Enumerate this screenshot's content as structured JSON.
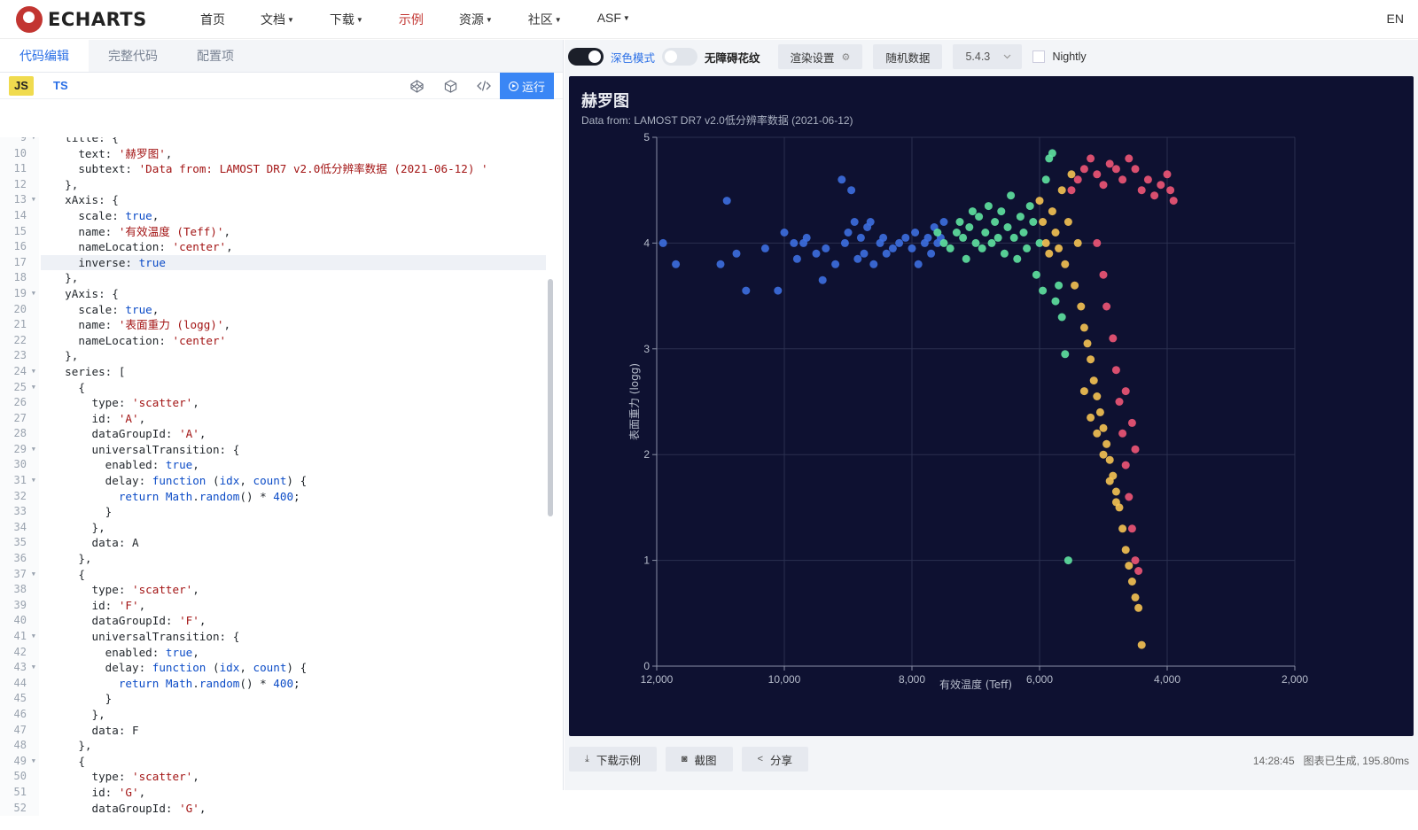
{
  "nav": {
    "brand": "ECHARTS",
    "items": [
      {
        "label": "首页",
        "caret": false,
        "active": false
      },
      {
        "label": "文档",
        "caret": true,
        "active": false
      },
      {
        "label": "下载",
        "caret": true,
        "active": false
      },
      {
        "label": "示例",
        "caret": false,
        "active": true
      },
      {
        "label": "资源",
        "caret": true,
        "active": false
      },
      {
        "label": "社区",
        "caret": true,
        "active": false
      },
      {
        "label": "ASF",
        "caret": true,
        "active": false
      }
    ],
    "lang": "EN"
  },
  "editor_tabs": [
    "代码编辑",
    "完整代码",
    "配置项"
  ],
  "lang_bar": {
    "js": "JS",
    "ts": "TS",
    "run": "运行"
  },
  "code_lines": [
    {
      "n": 9,
      "fold": true,
      "t": "  title: {"
    },
    {
      "n": 10,
      "t": "    text: '赫罗图',"
    },
    {
      "n": 11,
      "t": "    subtext: 'Data from: LAMOST DR7 v2.0低分辨率数据 (2021-06-12) '"
    },
    {
      "n": 12,
      "t": "  },"
    },
    {
      "n": 13,
      "fold": true,
      "t": "  xAxis: {"
    },
    {
      "n": 14,
      "t": "    scale: true,"
    },
    {
      "n": 15,
      "t": "    name: '有效温度 (Teff)',"
    },
    {
      "n": 16,
      "t": "    nameLocation: 'center',"
    },
    {
      "n": 17,
      "t": "    inverse: true",
      "hl": true
    },
    {
      "n": 18,
      "t": "  },"
    },
    {
      "n": 19,
      "fold": true,
      "t": "  yAxis: {"
    },
    {
      "n": 20,
      "t": "    scale: true,"
    },
    {
      "n": 21,
      "t": "    name: '表面重力 (logg)',"
    },
    {
      "n": 22,
      "t": "    nameLocation: 'center'"
    },
    {
      "n": 23,
      "t": "  },"
    },
    {
      "n": 24,
      "fold": true,
      "t": "  series: ["
    },
    {
      "n": 25,
      "fold": true,
      "t": "    {"
    },
    {
      "n": 26,
      "t": "      type: 'scatter',"
    },
    {
      "n": 27,
      "t": "      id: 'A',"
    },
    {
      "n": 28,
      "t": "      dataGroupId: 'A',"
    },
    {
      "n": 29,
      "fold": true,
      "t": "      universalTransition: {"
    },
    {
      "n": 30,
      "t": "        enabled: true,"
    },
    {
      "n": 31,
      "fold": true,
      "t": "        delay: function (idx, count) {"
    },
    {
      "n": 32,
      "t": "          return Math.random() * 400;"
    },
    {
      "n": 33,
      "t": "        }"
    },
    {
      "n": 34,
      "t": "      },"
    },
    {
      "n": 35,
      "t": "      data: A"
    },
    {
      "n": 36,
      "t": "    },"
    },
    {
      "n": 37,
      "fold": true,
      "t": "    {"
    },
    {
      "n": 38,
      "t": "      type: 'scatter',"
    },
    {
      "n": 39,
      "t": "      id: 'F',"
    },
    {
      "n": 40,
      "t": "      dataGroupId: 'F',"
    },
    {
      "n": 41,
      "fold": true,
      "t": "      universalTransition: {"
    },
    {
      "n": 42,
      "t": "        enabled: true,"
    },
    {
      "n": 43,
      "fold": true,
      "t": "        delay: function (idx, count) {"
    },
    {
      "n": 44,
      "t": "          return Math.random() * 400;"
    },
    {
      "n": 45,
      "t": "        }"
    },
    {
      "n": 46,
      "t": "      },"
    },
    {
      "n": 47,
      "t": "      data: F"
    },
    {
      "n": 48,
      "t": "    },"
    },
    {
      "n": 49,
      "fold": true,
      "t": "    {"
    },
    {
      "n": 50,
      "t": "      type: 'scatter',"
    },
    {
      "n": 51,
      "t": "      id: 'G',"
    },
    {
      "n": 52,
      "t": "      dataGroupId: 'G',"
    }
  ],
  "toolbar": {
    "dark_mode": "深色模式",
    "decal": "无障碍花纹",
    "render": "渲染设置",
    "random": "随机数据",
    "version": "5.4.3",
    "nightly": "Nightly"
  },
  "chart_data": {
    "type": "scatter",
    "title": "赫罗图",
    "subtitle": "Data from: LAMOST DR7 v2.0低分辨率数据 (2021-06-12)",
    "xlabel": "有效温度 (Teff)",
    "ylabel": "表面重力 (logg)",
    "x_inverse": true,
    "xlim": [
      2000,
      12000
    ],
    "ylim": [
      0,
      5
    ],
    "xticks": [
      12000,
      10000,
      8000,
      6000,
      4000,
      2000
    ],
    "xtick_labels": [
      "12,000",
      "10,000",
      "8,000",
      "6,000",
      "4,000",
      "2,000"
    ],
    "yticks": [
      0,
      1,
      2,
      3,
      4,
      5
    ],
    "grid": true,
    "colors": {
      "A": "#3d6fe0",
      "F": "#5fe3a1",
      "G": "#f5c353",
      "K": "#ef5777"
    },
    "series": [
      {
        "group": "A",
        "points": [
          [
            11900,
            4.0
          ],
          [
            11700,
            3.8
          ],
          [
            11000,
            3.8
          ],
          [
            10900,
            4.4
          ],
          [
            10750,
            3.9
          ],
          [
            10600,
            3.55
          ],
          [
            10300,
            3.95
          ],
          [
            10100,
            3.55
          ],
          [
            10000,
            4.1
          ],
          [
            9850,
            4.0
          ],
          [
            9800,
            3.85
          ],
          [
            9700,
            4.0
          ],
          [
            9650,
            4.05
          ],
          [
            9500,
            3.9
          ],
          [
            9400,
            3.65
          ],
          [
            9350,
            3.95
          ],
          [
            9200,
            3.8
          ],
          [
            9100,
            4.6
          ],
          [
            9050,
            4.0
          ],
          [
            9000,
            4.1
          ],
          [
            8950,
            4.5
          ],
          [
            8900,
            4.2
          ],
          [
            8850,
            3.85
          ],
          [
            8800,
            4.05
          ],
          [
            8750,
            3.9
          ],
          [
            8700,
            4.15
          ],
          [
            8650,
            4.2
          ],
          [
            8600,
            3.8
          ],
          [
            8500,
            4.0
          ],
          [
            8450,
            4.05
          ],
          [
            8400,
            3.9
          ],
          [
            8300,
            3.95
          ],
          [
            8200,
            4.0
          ],
          [
            8100,
            4.05
          ],
          [
            8000,
            3.95
          ],
          [
            7950,
            4.1
          ],
          [
            7900,
            3.8
          ],
          [
            7800,
            4.0
          ],
          [
            7750,
            4.05
          ],
          [
            7700,
            3.9
          ],
          [
            7650,
            4.15
          ],
          [
            7600,
            4.0
          ],
          [
            7550,
            4.05
          ],
          [
            7500,
            4.2
          ]
        ]
      },
      {
        "group": "F",
        "points": [
          [
            7600,
            4.1
          ],
          [
            7500,
            4.0
          ],
          [
            7400,
            3.95
          ],
          [
            7300,
            4.1
          ],
          [
            7250,
            4.2
          ],
          [
            7200,
            4.05
          ],
          [
            7150,
            3.85
          ],
          [
            7100,
            4.15
          ],
          [
            7050,
            4.3
          ],
          [
            7000,
            4.0
          ],
          [
            6950,
            4.25
          ],
          [
            6900,
            3.95
          ],
          [
            6850,
            4.1
          ],
          [
            6800,
            4.35
          ],
          [
            6750,
            4.0
          ],
          [
            6700,
            4.2
          ],
          [
            6650,
            4.05
          ],
          [
            6600,
            4.3
          ],
          [
            6550,
            3.9
          ],
          [
            6500,
            4.15
          ],
          [
            6450,
            4.45
          ],
          [
            6400,
            4.05
          ],
          [
            6350,
            3.85
          ],
          [
            6300,
            4.25
          ],
          [
            6250,
            4.1
          ],
          [
            6200,
            3.95
          ],
          [
            6150,
            4.35
          ],
          [
            6100,
            4.2
          ],
          [
            6050,
            3.7
          ],
          [
            6000,
            4.0
          ],
          [
            5950,
            3.55
          ],
          [
            5900,
            4.6
          ],
          [
            5850,
            4.8
          ],
          [
            5800,
            4.85
          ],
          [
            5750,
            3.45
          ],
          [
            5700,
            3.6
          ],
          [
            5650,
            3.3
          ],
          [
            5600,
            2.95
          ],
          [
            5550,
            1.0
          ]
        ]
      },
      {
        "group": "G",
        "points": [
          [
            6000,
            4.4
          ],
          [
            5950,
            4.2
          ],
          [
            5900,
            4.0
          ],
          [
            5850,
            3.9
          ],
          [
            5800,
            4.3
          ],
          [
            5750,
            4.1
          ],
          [
            5700,
            3.95
          ],
          [
            5650,
            4.5
          ],
          [
            5600,
            3.8
          ],
          [
            5550,
            4.2
          ],
          [
            5500,
            4.65
          ],
          [
            5450,
            3.6
          ],
          [
            5400,
            4.0
          ],
          [
            5350,
            3.4
          ],
          [
            5300,
            3.2
          ],
          [
            5250,
            3.05
          ],
          [
            5200,
            2.9
          ],
          [
            5150,
            2.7
          ],
          [
            5100,
            2.55
          ],
          [
            5050,
            2.4
          ],
          [
            5000,
            2.25
          ],
          [
            4950,
            2.1
          ],
          [
            4900,
            1.95
          ],
          [
            4850,
            1.8
          ],
          [
            4800,
            1.65
          ],
          [
            4750,
            1.5
          ],
          [
            4700,
            1.3
          ],
          [
            4650,
            1.1
          ],
          [
            4600,
            0.95
          ],
          [
            4550,
            0.8
          ],
          [
            4500,
            0.65
          ],
          [
            4450,
            0.55
          ],
          [
            4400,
            0.2
          ],
          [
            5300,
            2.6
          ],
          [
            5200,
            2.35
          ],
          [
            5100,
            2.2
          ],
          [
            5000,
            2.0
          ],
          [
            4900,
            1.75
          ],
          [
            4800,
            1.55
          ]
        ]
      },
      {
        "group": "K",
        "points": [
          [
            5500,
            4.5
          ],
          [
            5400,
            4.6
          ],
          [
            5300,
            4.7
          ],
          [
            5200,
            4.8
          ],
          [
            5100,
            4.65
          ],
          [
            5000,
            4.55
          ],
          [
            4900,
            4.75
          ],
          [
            4800,
            4.7
          ],
          [
            4700,
            4.6
          ],
          [
            4600,
            4.8
          ],
          [
            4500,
            4.7
          ],
          [
            4400,
            4.5
          ],
          [
            4300,
            4.6
          ],
          [
            4200,
            4.45
          ],
          [
            4100,
            4.55
          ],
          [
            4000,
            4.65
          ],
          [
            3950,
            4.5
          ],
          [
            3900,
            4.4
          ],
          [
            5100,
            4.0
          ],
          [
            5000,
            3.7
          ],
          [
            4950,
            3.4
          ],
          [
            4850,
            3.1
          ],
          [
            4800,
            2.8
          ],
          [
            4750,
            2.5
          ],
          [
            4700,
            2.2
          ],
          [
            4650,
            1.9
          ],
          [
            4600,
            1.6
          ],
          [
            4550,
            1.3
          ],
          [
            4500,
            1.0
          ],
          [
            4450,
            0.9
          ],
          [
            4650,
            2.6
          ],
          [
            4550,
            2.3
          ],
          [
            4500,
            2.05
          ]
        ]
      }
    ]
  },
  "bottom": {
    "download": "下载示例",
    "screenshot": "截图",
    "share": "分享",
    "time": "14:28:45",
    "status": "图表已生成, 195.80ms"
  }
}
